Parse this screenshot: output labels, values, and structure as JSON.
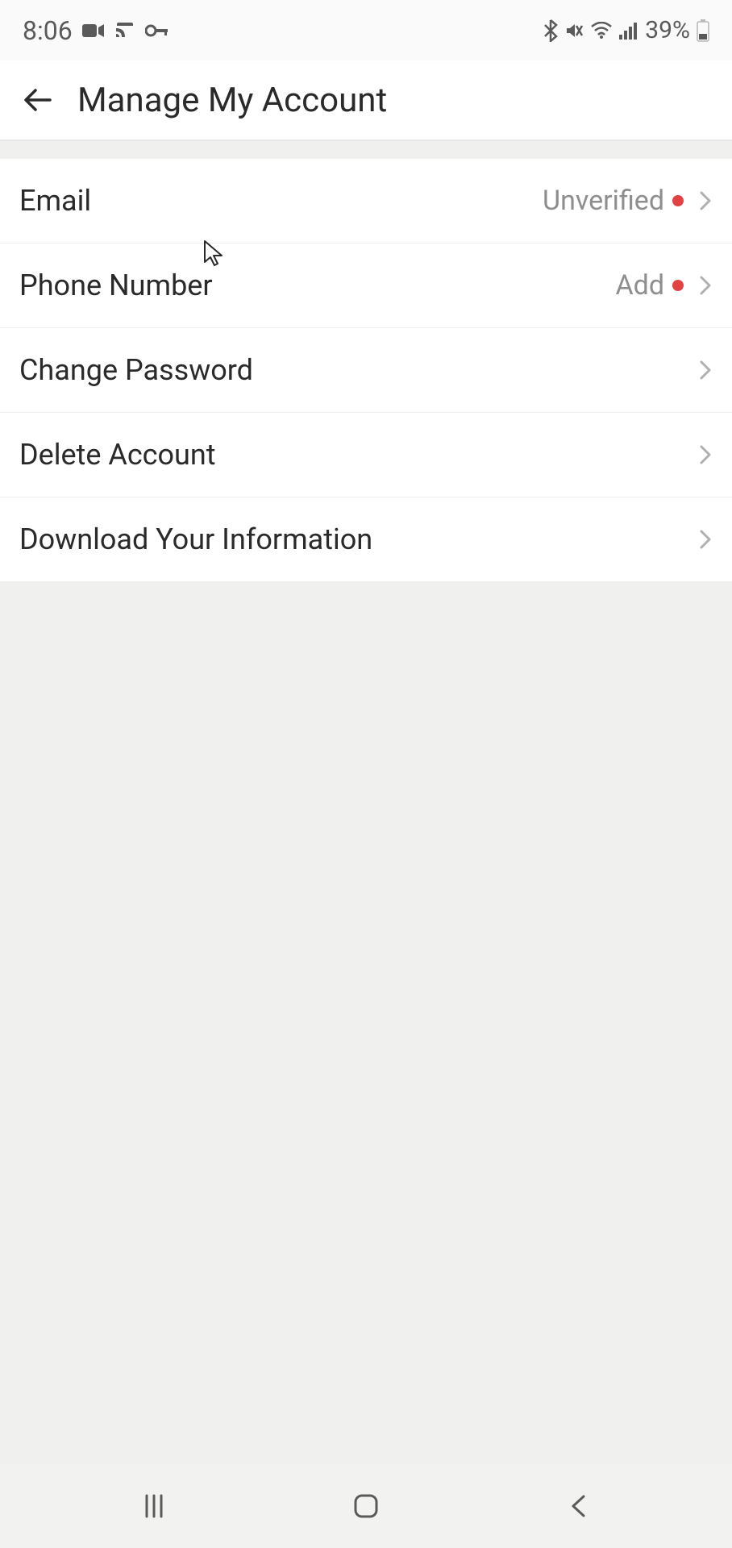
{
  "status_bar": {
    "time": "8:06",
    "battery_percent": "39%"
  },
  "header": {
    "title": "Manage My Account"
  },
  "settings": {
    "items": [
      {
        "label": "Email",
        "status": "Unverified",
        "dot": true
      },
      {
        "label": "Phone Number",
        "status": "Add",
        "dot": true
      },
      {
        "label": "Change Password",
        "status": "",
        "dot": false
      },
      {
        "label": "Delete Account",
        "status": "",
        "dot": false
      },
      {
        "label": "Download Your Information",
        "status": "",
        "dot": false
      }
    ]
  }
}
